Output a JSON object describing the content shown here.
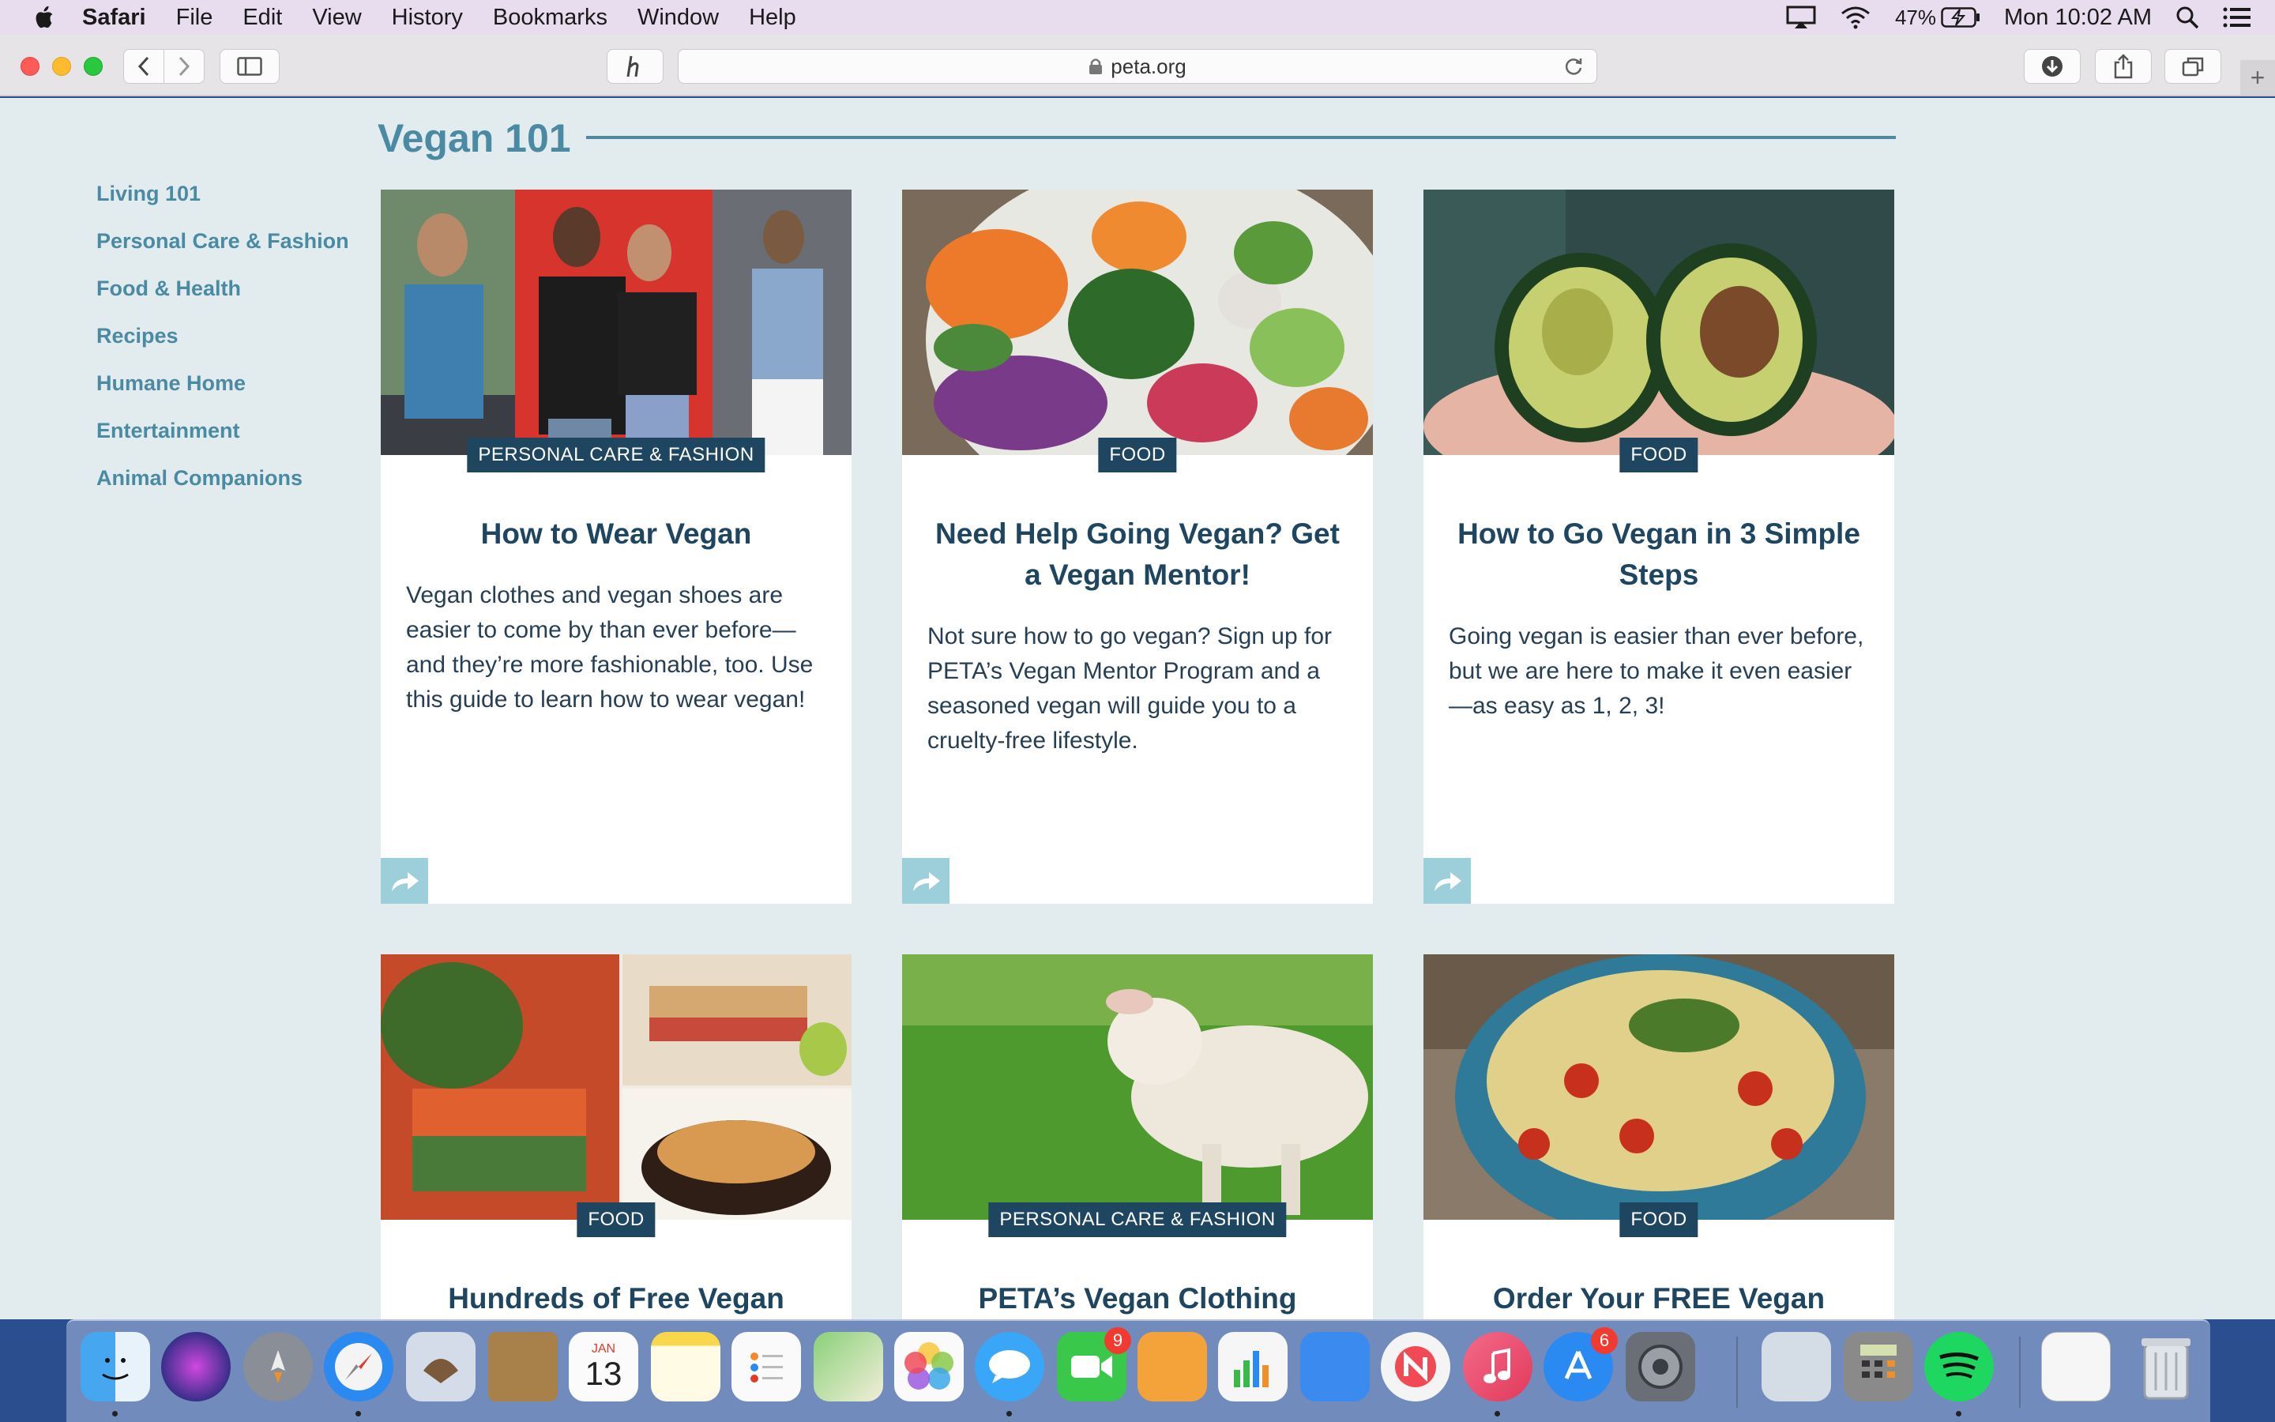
{
  "menubar": {
    "app": "Safari",
    "items": [
      "File",
      "Edit",
      "View",
      "History",
      "Bookmarks",
      "Window",
      "Help"
    ],
    "battery": "47%",
    "clock": "Mon 10:02 AM"
  },
  "browser": {
    "url": "peta.org"
  },
  "page": {
    "section_title": "Vegan 101",
    "sidenav": [
      "Living 101",
      "Personal Care & Fashion",
      "Food & Health",
      "Recipes",
      "Humane Home",
      "Entertainment",
      "Animal Companions"
    ],
    "cards": [
      {
        "category": "PERSONAL CARE & FASHION",
        "title": "How to Wear Vegan",
        "description": "Vegan clothes and vegan shoes are easier to come by than ever before—and they’re more fashionable, too. Use this guide to learn how to wear vegan!"
      },
      {
        "category": "FOOD",
        "title": "Need Help Going Vegan? Get a Vegan Mentor!",
        "description": "Not sure how to go vegan? Sign up for PETA’s Vegan Mentor Program and a seasoned vegan will guide you to a cruelty-free lifestyle."
      },
      {
        "category": "FOOD",
        "title": "How to Go Vegan in 3 Simple Steps",
        "description": "Going vegan is easier than ever before, but we are here to make it even easier—as easy as 1, 2, 3!"
      },
      {
        "category": "FOOD",
        "title": "Hundreds of Free Vegan"
      },
      {
        "category": "PERSONAL CARE & FASHION",
        "title": "PETA’s Vegan Clothing"
      },
      {
        "category": "FOOD",
        "title": "Order Your FREE Vegan"
      }
    ]
  },
  "dock": {
    "calendar_month": "JAN",
    "calendar_day": "13",
    "facetime_badge": "9",
    "appstore_badge": "6"
  },
  "colors": {
    "accent": "#4a8aa2",
    "badge_bg": "#1e4660",
    "page_bg": "#e2ecef",
    "share_btn": "#9ccfd9"
  }
}
